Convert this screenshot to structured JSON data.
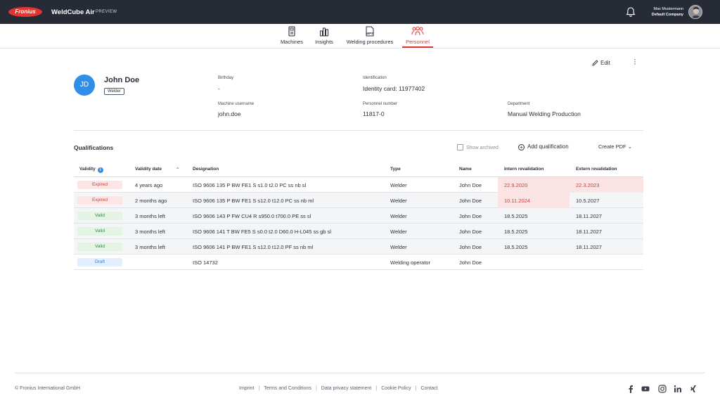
{
  "header": {
    "logo_text": "Fronius",
    "app_name": "WeldCube Air",
    "preview_label": "PREVIEW",
    "user_name": "Max Mustermann",
    "user_company": "Default Company"
  },
  "nav": {
    "items": [
      {
        "label": "Machines",
        "icon": "machine-icon"
      },
      {
        "label": "Insights",
        "icon": "bar-chart-icon"
      },
      {
        "label": "Welding procedures",
        "icon": "wps-document-icon"
      },
      {
        "label": "Personnel",
        "icon": "people-icon",
        "active": true
      }
    ]
  },
  "actions": {
    "edit_label": "Edit"
  },
  "profile": {
    "initials": "JD",
    "name": "John Doe",
    "role_tag": "Welder",
    "fields": {
      "birthday": {
        "label": "Birthday",
        "value": "-"
      },
      "identification": {
        "label": "Identification",
        "value": "Identity card: 11977402"
      },
      "machine_username": {
        "label": "Machine username",
        "value": "john.doe"
      },
      "personnel_number": {
        "label": "Personnel number",
        "value": "11817-0"
      },
      "department": {
        "label": "Department",
        "value": "Manual Welding Production"
      }
    }
  },
  "qualifications": {
    "title": "Qualifications",
    "show_archived": "Show archived",
    "add_label": "Add qualification",
    "create_pdf": "Create PDF",
    "columns": [
      "Validity",
      "Validity date",
      "Designation",
      "Type",
      "Name",
      "Intern revalidation",
      "Extern revalidation"
    ],
    "rows": [
      {
        "validity": "Expired",
        "validity_date": "4 years ago",
        "designation": "ISO 9606 135 P BW FE1 S s1.0 t2.0 PC ss nb sl",
        "type": "Welder",
        "name": "John Doe",
        "intern": "22.9.2020",
        "extern": "22.3.2023",
        "intern_expired": true,
        "extern_expired": true
      },
      {
        "validity": "Expired",
        "validity_date": "2 months ago",
        "designation": "ISO 9606 135 P BW FE1 S s12.0 t12.0 PC ss nb ml",
        "type": "Welder",
        "name": "John Doe",
        "intern": "10.11.2024",
        "extern": "10.5.2027",
        "intern_expired": true,
        "extern_expired": false
      },
      {
        "validity": "Valid",
        "validity_date": "3 months left",
        "designation": "ISO 9606 143 P FW CU4 R s950.0 t700.0 PE ss sl",
        "type": "Welder",
        "name": "John Doe",
        "intern": "18.5.2025",
        "extern": "18.11.2027",
        "intern_expired": false,
        "extern_expired": false
      },
      {
        "validity": "Valid",
        "validity_date": "3 months left",
        "designation": "ISO 9606 141 T BW FE5 S s0.0 t2.0 D60.0 H-L045 ss gb sl",
        "type": "Welder",
        "name": "John Doe",
        "intern": "18.5.2025",
        "extern": "18.11.2027",
        "intern_expired": false,
        "extern_expired": false
      },
      {
        "validity": "Valid",
        "validity_date": "3 months left",
        "designation": "ISO 9606 141 P BW FE1 S s12.0 t12.0 PF ss nb ml",
        "type": "Welder",
        "name": "John Doe",
        "intern": "18.5.2025",
        "extern": "18.11.2027",
        "intern_expired": false,
        "extern_expired": false
      },
      {
        "validity": "Draft",
        "validity_date": "",
        "designation": "ISO 14732",
        "type": "Welding operator",
        "name": "John Doe",
        "intern": "",
        "extern": "",
        "intern_expired": false,
        "extern_expired": false
      }
    ]
  },
  "footer": {
    "copyright": "© Fronius International GmbH",
    "links": [
      "Imprint",
      "Terms and Conditions",
      "Data privacy statement",
      "Cookie Policy",
      "Contact"
    ],
    "social_icons": [
      "facebook-icon",
      "youtube-icon",
      "instagram-icon",
      "linkedin-icon",
      "xing-icon"
    ]
  },
  "colors": {
    "topbar": "#262b36",
    "accent_red": "#e3342f",
    "avatar_blue": "#2e8ee8",
    "expired_bg": "#fde5e5",
    "valid_bg": "#e3f4e5",
    "draft_bg": "#e3efff"
  }
}
